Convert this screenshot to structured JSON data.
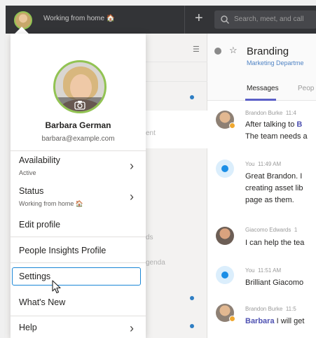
{
  "topbar": {
    "status_text": "Working from home 🏠",
    "search_placeholder": "Search, meet, and call"
  },
  "channel": {
    "name": "Branding",
    "team": "Marketing Departme",
    "tabs": [
      "Messages",
      "Peop"
    ]
  },
  "left_pane": {
    "fragments": [
      "ent",
      "ds",
      "genda"
    ]
  },
  "messages": [
    {
      "author": "Brandon Burke",
      "time": "11:4",
      "lines": [
        "After talking to B",
        "The team needs a"
      ],
      "avatar": "face"
    },
    {
      "author": "You",
      "time": "11:49 AM",
      "lines": [
        "Great Brandon. I",
        "creating asset lib",
        "page as them."
      ],
      "avatar": "you"
    },
    {
      "author": "Giacomo Edwards",
      "time": "1",
      "lines": [
        "I can help the tea"
      ],
      "avatar": "face2"
    },
    {
      "author": "You",
      "time": "11:51 AM",
      "lines": [
        "Brilliant Giacomo"
      ],
      "avatar": "you"
    },
    {
      "author": "Brandon Burke",
      "time": "11:5",
      "lines": [
        "Barbara I will get"
      ],
      "avatar": "face"
    }
  ],
  "profile": {
    "name": "Barbara German",
    "email": "barbara@example.com"
  },
  "menu": {
    "availability_label": "Availability",
    "availability_value": "Active",
    "status_label": "Status",
    "status_value": "Working from home 🏠",
    "edit_profile": "Edit profile",
    "people_insights": "People Insights Profile",
    "settings": "Settings",
    "whats_new": "What's New",
    "help": "Help",
    "chevron": "›"
  },
  "colors": {
    "presence_green": "#92c353",
    "focus_blue": "#1a86d6",
    "brand_purple": "#5b5fc7",
    "topbar": "#333437"
  },
  "icons": [
    "plus-icon",
    "search-icon",
    "filter-icon",
    "star-icon",
    "camera-icon",
    "chevron-right-icon",
    "cursor-icon"
  ]
}
